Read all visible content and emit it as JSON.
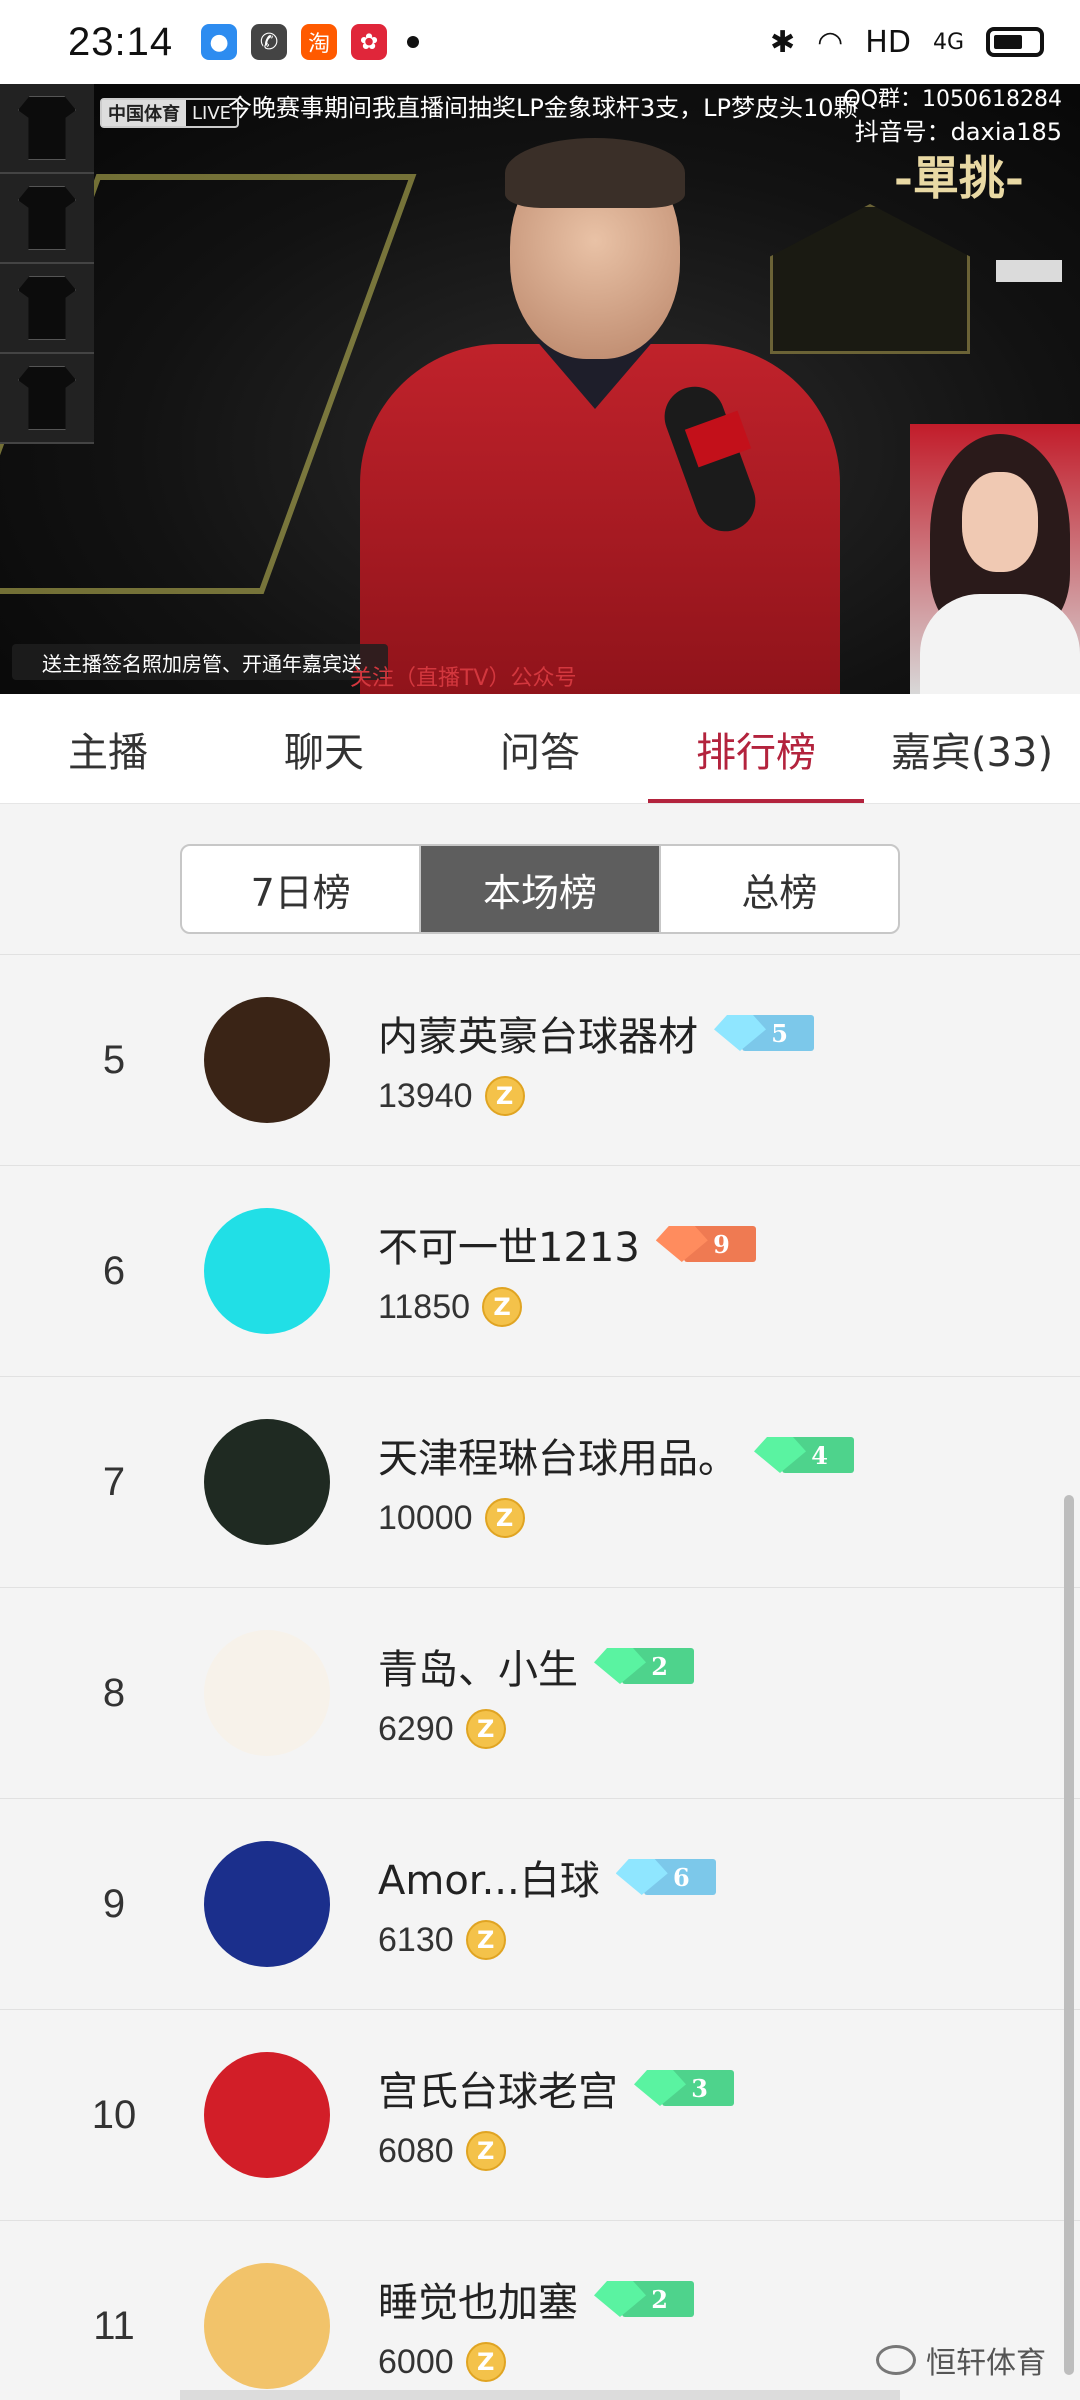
{
  "status_bar": {
    "time": "23:14",
    "notifications": [
      {
        "icon": "browser-icon",
        "glyph": "●",
        "color": "#2d8cf0"
      },
      {
        "icon": "chat-icon",
        "glyph": "✆",
        "color": "#444444"
      },
      {
        "icon": "taobao-icon",
        "glyph": "淘",
        "color": "#ff5a00"
      },
      {
        "icon": "app-icon",
        "glyph": "✿",
        "color": "#e0263a"
      }
    ],
    "network": "HD",
    "signal": "4G"
  },
  "video": {
    "live_brand": "中国体育",
    "live_label": "LIVE",
    "scroll_notice": "今晚赛事期间我直播间抽奖LP金象球杆3支，LP梦皮头10颗",
    "qq_group": "QQ群：1050618284",
    "tiktok_id": "抖音号：daxia185",
    "corner_logo": "-單挑-",
    "gift_hint": "送主播签名照加房管、开通年嘉宾送",
    "follow_hint": "关注（直播TV）公众号"
  },
  "tabs": [
    {
      "label": "主播",
      "active": false
    },
    {
      "label": "聊天",
      "active": false
    },
    {
      "label": "问答",
      "active": false
    },
    {
      "label": "排行榜",
      "active": true
    },
    {
      "label": "嘉宾(33)",
      "active": false
    }
  ],
  "segment": [
    {
      "label": "7日榜",
      "active": false
    },
    {
      "label": "本场榜",
      "active": true
    },
    {
      "label": "总榜",
      "active": false
    }
  ],
  "rankings": [
    {
      "rank": "5",
      "name": "内蒙英豪台球器材",
      "level": "5",
      "badge_color": "#7cc8ea",
      "score": "13940",
      "avatar": "brand-logo-avatar",
      "avatar_bg": "#3a2416"
    },
    {
      "rank": "6",
      "name": "不可一世1213",
      "level": "9",
      "badge_color": "#ef7a52",
      "score": "11850",
      "avatar": "sketch-avatar",
      "avatar_bg": "#21dfe6"
    },
    {
      "rank": "7",
      "name": "天津程琳台球用品。",
      "level": "4",
      "badge_color": "#4ed38c",
      "score": "10000",
      "avatar": "player-photo-avatar",
      "avatar_bg": "#1f2a22"
    },
    {
      "rank": "8",
      "name": "青岛、小生",
      "level": "2",
      "badge_color": "#4ed38c",
      "score": "6290",
      "avatar": "cartoon-avatar",
      "avatar_bg": "#f7f2ea"
    },
    {
      "rank": "9",
      "name": "Amor...白球",
      "level": "6",
      "badge_color": "#7cc8ea",
      "score": "6130",
      "avatar": "night-city-avatar",
      "avatar_bg": "#1b2f8c"
    },
    {
      "rank": "10",
      "name": "宫氏台球老宫",
      "level": "3",
      "badge_color": "#4ed38c",
      "score": "6080",
      "avatar": "g-logo-avatar",
      "avatar_bg": "#d21e28"
    },
    {
      "rank": "11",
      "name": "睡觉也加塞",
      "level": "2",
      "badge_color": "#4ed38c",
      "score": "6000",
      "avatar": "guitar-avatar",
      "avatar_bg": "#f2c36a"
    }
  ],
  "coin_symbol": "Z",
  "watermark": "恒轩体育"
}
